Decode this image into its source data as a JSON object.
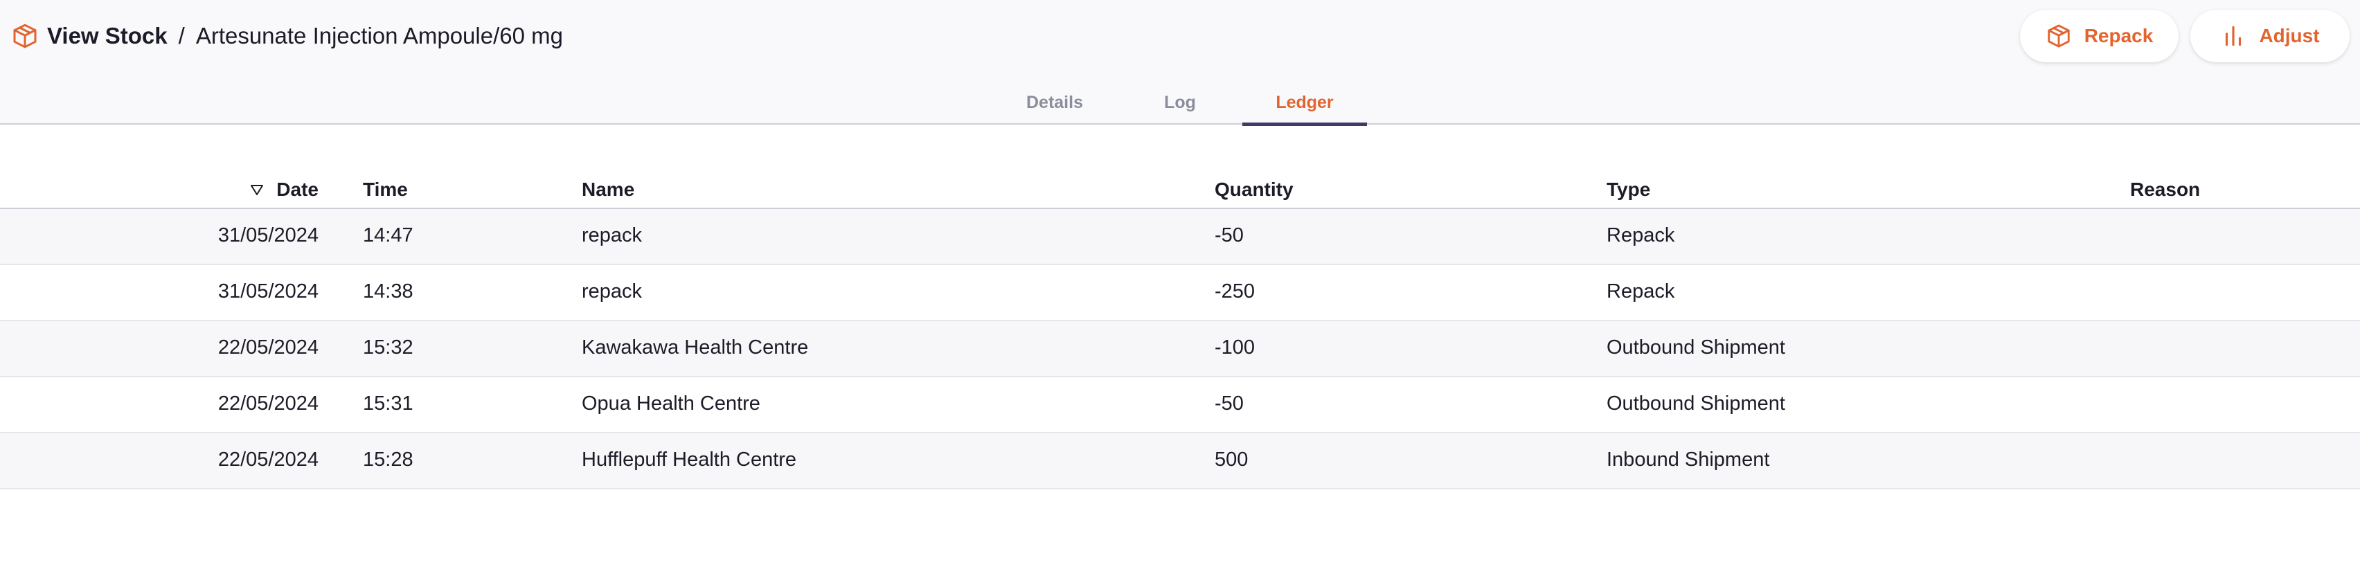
{
  "header": {
    "breadcrumb_root": "View Stock",
    "breadcrumb_separator": "/",
    "breadcrumb_current": "Artesunate Injection Ampoule/60 mg",
    "repack_label": "Repack",
    "adjust_label": "Adjust",
    "logo_icon": "cube-icon",
    "accent_color": "#e2642f"
  },
  "tabs": [
    {
      "label": "Details",
      "active": false
    },
    {
      "label": "Log",
      "active": false
    },
    {
      "label": "Ledger",
      "active": true
    }
  ],
  "table": {
    "sort_column": "Date",
    "sort_direction": "descending",
    "columns": [
      "Date",
      "Time",
      "Name",
      "Quantity",
      "Type",
      "Reason"
    ],
    "rows": [
      {
        "date": "31/05/2024",
        "time": "14:47",
        "name": "repack",
        "quantity": "-50",
        "type": "Repack",
        "reason": ""
      },
      {
        "date": "31/05/2024",
        "time": "14:38",
        "name": "repack",
        "quantity": "-250",
        "type": "Repack",
        "reason": ""
      },
      {
        "date": "22/05/2024",
        "time": "15:32",
        "name": "Kawakawa Health Centre",
        "quantity": "-100",
        "type": "Outbound Shipment",
        "reason": ""
      },
      {
        "date": "22/05/2024",
        "time": "15:31",
        "name": "Opua Health Centre",
        "quantity": "-50",
        "type": "Outbound Shipment",
        "reason": ""
      },
      {
        "date": "22/05/2024",
        "time": "15:28",
        "name": "Hufflepuff Health Centre",
        "quantity": "500",
        "type": "Inbound Shipment",
        "reason": ""
      }
    ]
  }
}
